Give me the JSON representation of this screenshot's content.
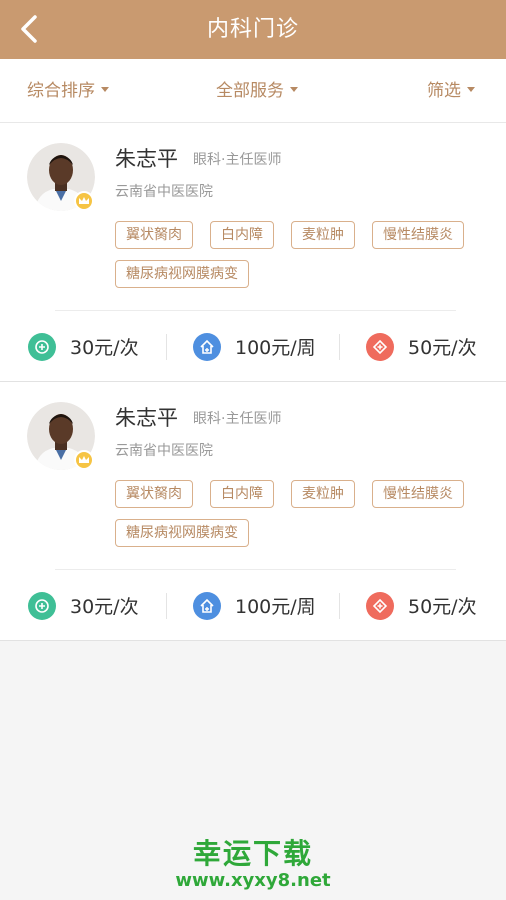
{
  "header": {
    "title": "内科门诊"
  },
  "filters": [
    {
      "label": "综合排序"
    },
    {
      "label": "全部服务"
    },
    {
      "label": "筛选"
    }
  ],
  "doctors": [
    {
      "name": "朱志平",
      "title": "眼科·主任医师",
      "hospital": "云南省中医医院",
      "tags": [
        "翼状胬肉",
        "白内障",
        "麦粒肿",
        "慢性结膜炎",
        "糖尿病视网膜病变"
      ],
      "prices": [
        {
          "icon": "consult-icon",
          "color": "#3fbf96",
          "label": "30元/次"
        },
        {
          "icon": "home-icon",
          "color": "#4e8fe0",
          "label": "100元/周"
        },
        {
          "icon": "phone-icon",
          "color": "#ef6b5d",
          "label": "50元/次"
        }
      ]
    },
    {
      "name": "朱志平",
      "title": "眼科·主任医师",
      "hospital": "云南省中医医院",
      "tags": [
        "翼状胬肉",
        "白内障",
        "麦粒肿",
        "慢性结膜炎",
        "糖尿病视网膜病变"
      ],
      "prices": [
        {
          "icon": "consult-icon",
          "color": "#3fbf96",
          "label": "30元/次"
        },
        {
          "icon": "home-icon",
          "color": "#4e8fe0",
          "label": "100元/周"
        },
        {
          "icon": "phone-icon",
          "color": "#ef6b5d",
          "label": "50元/次"
        }
      ]
    }
  ],
  "watermark": {
    "title": "幸运下载",
    "url": "www.xyxy8.net"
  },
  "colors": {
    "header_bg": "#c99a70",
    "accent": "#b78a63",
    "tag_border": "#d9b08c",
    "watermark": "#2fa839"
  }
}
